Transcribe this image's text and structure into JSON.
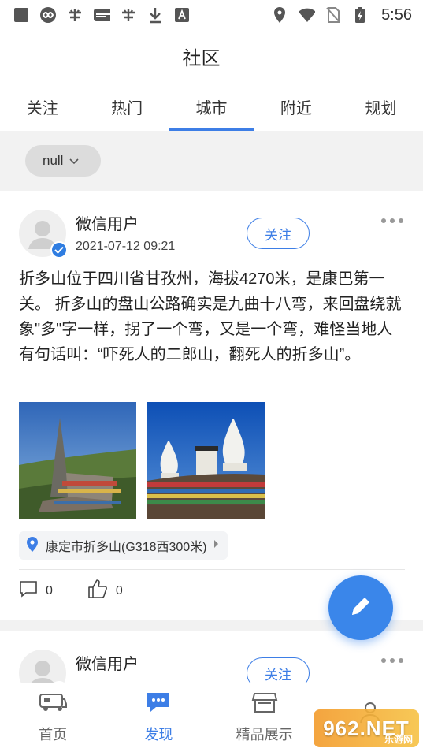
{
  "status_bar": {
    "time": "5:56",
    "left_icons": [
      "square-icon",
      "infinity-icon",
      "bug-icon",
      "app-badge-icon",
      "bug-icon",
      "download-icon",
      "text-a-icon"
    ],
    "right_icons": [
      "location-pin-icon",
      "wifi-icon",
      "no-sim-icon",
      "battery-charging-icon"
    ]
  },
  "header": {
    "title": "社区"
  },
  "tabs": [
    {
      "label": "关注",
      "active": false
    },
    {
      "label": "热门",
      "active": false
    },
    {
      "label": "城市",
      "active": true
    },
    {
      "label": "附近",
      "active": false
    },
    {
      "label": "规划",
      "active": false
    }
  ],
  "filter": {
    "chip_label": "null"
  },
  "posts": [
    {
      "username": "微信用户",
      "time": "2021-07-12 09:21",
      "follow_label": "关注",
      "content": "折多山位于四川省甘孜州，海拔4270米，是康巴第一关。 折多山的盘山公路确实是九曲十八弯，来回盘绕就象\"多\"字一样，拐了一个弯，又是一个弯，难怪当地人有句话叫：“吓死人的二郎山，翻死人的折多山”。",
      "location": "康定市折多山(G318西300米)",
      "comments": "0",
      "likes": "0"
    },
    {
      "username": "微信用户",
      "follow_label": "关注"
    }
  ],
  "bottom_nav": [
    {
      "label": "首页",
      "icon": "camper-van-icon",
      "active": false
    },
    {
      "label": "发现",
      "icon": "chat-bubble-icon",
      "active": true
    },
    {
      "label": "精品展示",
      "icon": "storefront-icon",
      "active": false
    },
    {
      "label": "",
      "icon": "person-icon",
      "active": false
    }
  ],
  "watermark": {
    "text": "962.NET",
    "sub": "乐游网"
  },
  "colors": {
    "accent": "#3d7ee6",
    "fab": "#3a86ea",
    "background_band": "#f2f2f2"
  }
}
